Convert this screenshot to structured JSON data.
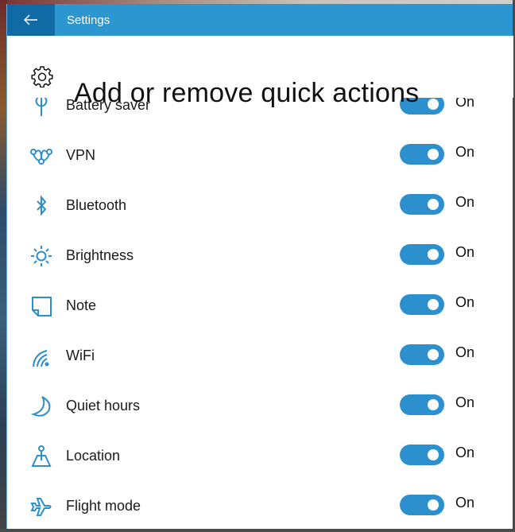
{
  "window": {
    "title": "Settings",
    "back_label": "Back"
  },
  "page": {
    "title": "Add or remove quick actions",
    "icon": "gear-icon"
  },
  "colors": {
    "accent": "#2c8fce",
    "titlebar": "#2b96cf",
    "back_button": "#0f6aa6"
  },
  "quick_actions": [
    {
      "label": "Battery saver",
      "icon": "battery-saver-icon",
      "state": "On",
      "enabled": true
    },
    {
      "label": "VPN",
      "icon": "vpn-icon",
      "state": "On",
      "enabled": true
    },
    {
      "label": "Bluetooth",
      "icon": "bluetooth-icon",
      "state": "On",
      "enabled": true
    },
    {
      "label": "Brightness",
      "icon": "brightness-icon",
      "state": "On",
      "enabled": true
    },
    {
      "label": "Note",
      "icon": "note-icon",
      "state": "On",
      "enabled": true
    },
    {
      "label": "WiFi",
      "icon": "wifi-icon",
      "state": "On",
      "enabled": true
    },
    {
      "label": "Quiet hours",
      "icon": "quiet-hours-icon",
      "state": "On",
      "enabled": true
    },
    {
      "label": "Location",
      "icon": "location-icon",
      "state": "On",
      "enabled": true
    },
    {
      "label": "Flight mode",
      "icon": "flight-mode-icon",
      "state": "On",
      "enabled": true
    }
  ]
}
